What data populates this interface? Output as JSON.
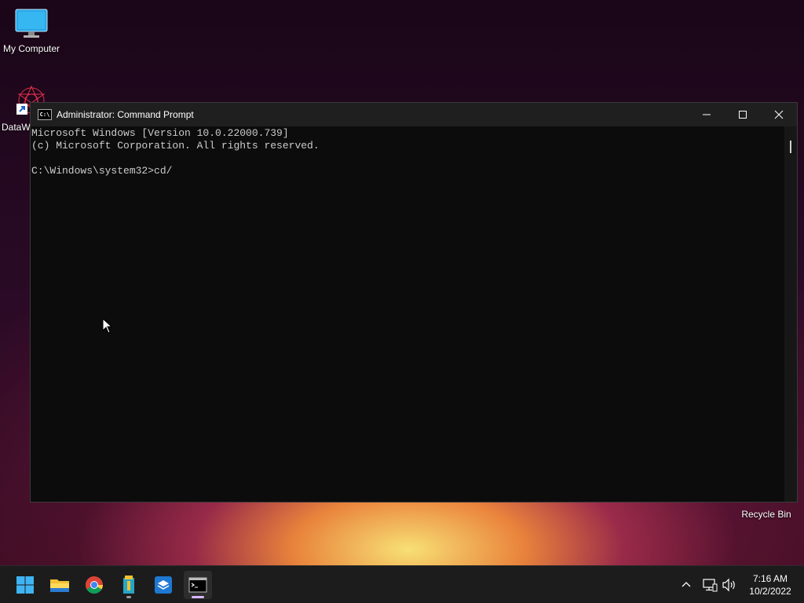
{
  "desktop": {
    "icons": [
      {
        "label": "My Computer"
      },
      {
        "label": "DataW"
      },
      {
        "label": "Recycle Bin"
      }
    ]
  },
  "window": {
    "title": "Administrator: Command Prompt",
    "icon_text": "C:\\",
    "console_lines": [
      "Microsoft Windows [Version 10.0.22000.739]",
      "(c) Microsoft Corporation. All rights reserved.",
      "",
      "C:\\Windows\\system32>cd/"
    ]
  },
  "taskbar": {
    "apps": [
      {
        "icon": "windows-start-icon"
      },
      {
        "icon": "file-explorer-icon"
      },
      {
        "icon": "chrome-icon"
      },
      {
        "icon": "archive-app-icon"
      },
      {
        "icon": "sandbox-app-icon"
      },
      {
        "icon": "command-prompt-icon"
      }
    ],
    "clock": {
      "time": "7:16 AM",
      "date": "10/2/2022"
    }
  }
}
